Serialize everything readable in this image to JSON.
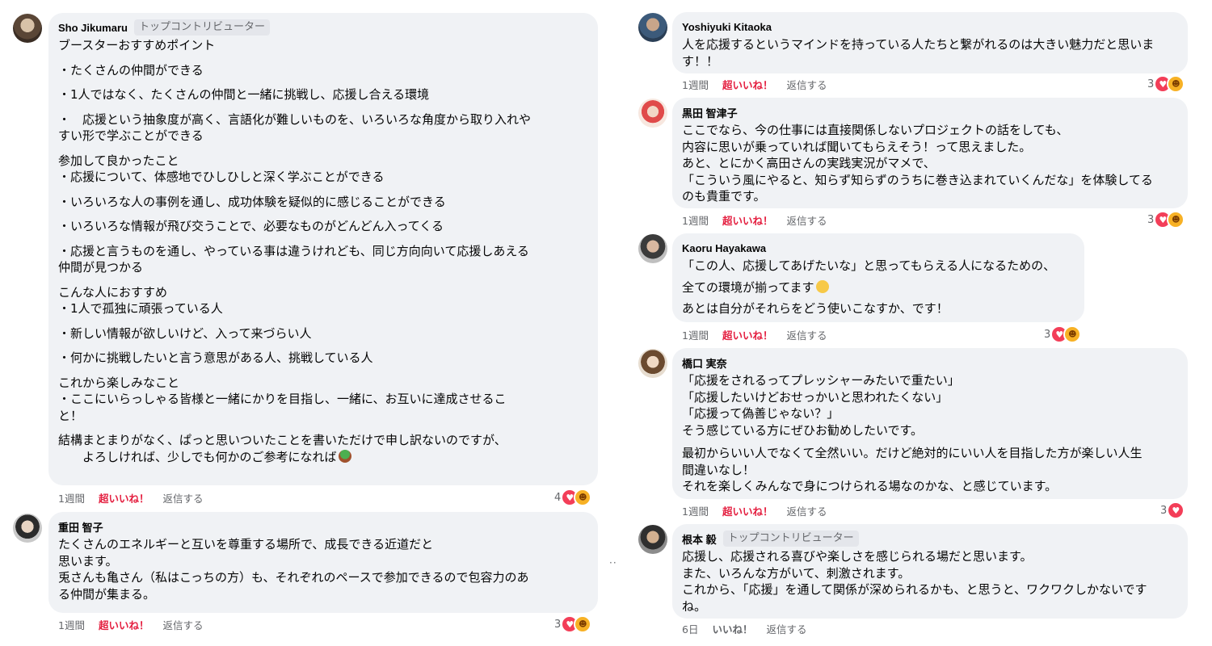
{
  "left": {
    "c1": {
      "author": "Sho Jikumaru",
      "badge": "トップコントリビューター",
      "lines": [
        "ブースターおすすめポイント",
        "・たくさんの仲間ができる",
        "・1人ではなく、たくさんの仲間と一緒に挑戦し、応援し合える環境",
        "・　応援という抽象度が高く、言語化が難しいものを、いろいろな角度から取り入れや",
        "すい形で学ぶことができる",
        "参加して良かったこと",
        "・応援について、体感地でひしひしと深く学ぶことができる",
        "・いろいろな人の事例を通し、成功体験を疑似的に感じることができる",
        "・いろいろな情報が飛び交うことで、必要なものがどんどん入ってくる",
        "・応援と言うものを通し、やっている事は違うけれども、同じ方向向いて応援しあえる",
        "仲間が見つかる",
        "こんな人におすすめ",
        "・1人で孤独に頑張っている人",
        "・新しい情報が欲しいけど、入って来づらい人",
        "・何かに挑戦したいと言う意思がある人、挑戦している人",
        "これから楽しみなこと",
        "・ここにいらっしゃる皆様と一緒にかりを目指し、一緒に、お互いに達成させるこ",
        "と！",
        "結構まとまりがなく、ぱっと思いついたことを書いただけで申し訳ないのですが、",
        "　　よろしければ、少しでも何かのご参考になれば"
      ],
      "time": "1週間",
      "like": "超いいね！",
      "reply": "返信する",
      "count": "4"
    },
    "c2": {
      "author": "重田 智子",
      "lines": [
        "たくさんのエネルギーと互いを尊重する場所で、成長できる近道だと",
        "思います。",
        "兎さんも亀さん（私はこっちの方）も、それぞれのペースで参加できるので包容力のあ",
        "る仲間が集まる。"
      ],
      "time": "1週間",
      "like": "超いいね！",
      "reply": "返信する",
      "count": "3"
    }
  },
  "right": {
    "c1": {
      "author": "Yoshiyuki Kitaoka",
      "lines": [
        "人を応援するというマインドを持っている人たちと繋がれるのは大きい魅力だと思いま",
        "す！！"
      ],
      "time": "1週間",
      "like": "超いいね！",
      "reply": "返信する",
      "count": "3"
    },
    "c2": {
      "author": "黒田 智津子",
      "lines": [
        "ここでなら、今の仕事には直接関係しないプロジェクトの話をしても、",
        "内容に思いが乗っていれば聞いてもらえそう！って思えました。",
        "あと、とにかく高田さんの実践実況がマメで、",
        "「こういう風にやると、知らず知らずのうちに巻き込まれていくんだな」を体験してる",
        "のも貴重です。"
      ],
      "time": "1週間",
      "like": "超いいね！",
      "reply": "返信する",
      "count": "3"
    },
    "c3": {
      "author": "Kaoru Hayakawa",
      "lines": [
        "「この人、応援してあげたいな」と思ってもらえる人になるための、",
        "全ての環境が揃ってます",
        "あとは自分がそれらをどう使いこなすか、です！"
      ],
      "time": "1週間",
      "like": "超いいね！",
      "reply": "返信する",
      "count": "3"
    },
    "c4": {
      "author": "橋口 実奈",
      "lines": [
        "「応援をされるってプレッシャーみたいで重たい」",
        "「応援したいけどおせっかいと思われたくない」",
        "「応援って偽善じゃない？」",
        "そう感じている方にぜひお勧めしたいです。",
        "最初からいい人でなくて全然いい。だけど絶対的にいい人を目指した方が楽しい人生",
        "間違いなし！",
        "それを楽しくみんなで身につけられる場なのかな、と感じています。"
      ],
      "time": "1週間",
      "like": "超いいね！",
      "reply": "返信する",
      "count": "3"
    },
    "c5": {
      "author": "根本 毅",
      "badge": "トップコントリビューター",
      "lines": [
        "応援し、応援される喜びや楽しさを感じられる場だと思います。",
        "また、いろんな方がいて、刺激されます。",
        "これから、「応援」を通して関係が深められるかも、と思うと、ワクワクしかないです",
        "ね。"
      ],
      "time": "6日",
      "like": "いいね！",
      "reply": "返信する"
    }
  },
  "icons": {
    "reaction_love": "heart-icon",
    "reaction_care": "care-icon",
    "emoji_flushed": "flushed-face-emoji",
    "emoji_plant": "potted-plant-emoji"
  },
  "colors": {
    "bubble": "#f0f2f5",
    "love": "#f33e58",
    "care": "#f7b125",
    "like_text": "#e41e3f"
  }
}
